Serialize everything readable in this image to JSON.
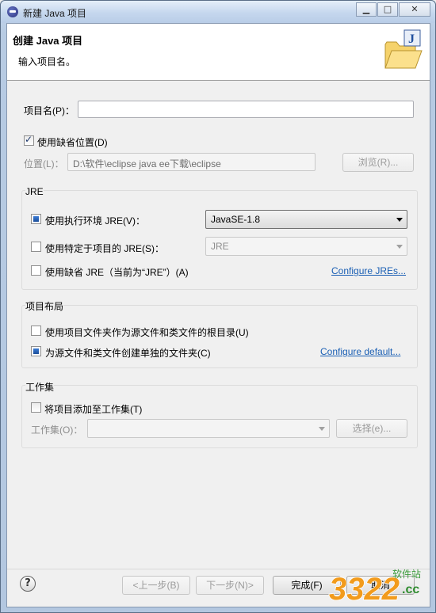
{
  "window": {
    "title": "新建 Java 项目",
    "minimize_glyph": "▁",
    "maximize_glyph": "□",
    "close_glyph": "✕"
  },
  "header": {
    "title": "创建 Java 项目",
    "description": "输入项目名。"
  },
  "project_name": {
    "label": "项目名(P)：",
    "value": ""
  },
  "location": {
    "use_default_label": "使用缺省位置(D)",
    "use_default_checked": true,
    "label": "位置(L)：",
    "value": "D:\\软件\\eclipse java ee下载\\eclipse",
    "browse_label": "浏览(R)..."
  },
  "jre": {
    "group_label": "JRE",
    "option_env_label": "使用执行环境 JRE(V)：",
    "option_env_value": "JavaSE-1.8",
    "option_project_label": "使用特定于项目的 JRE(S)：",
    "option_project_value": "JRE",
    "option_default_label": "使用缺省 JRE（当前为“JRE”）(A)",
    "configure_link": "Configure JREs...",
    "selected": "env"
  },
  "layout": {
    "group_label": "项目布局",
    "option_root_label": "使用项目文件夹作为源文件和类文件的根目录(U)",
    "option_separate_label": "为源文件和类文件创建单独的文件夹(C)",
    "configure_link": "Configure default...",
    "selected": "separate"
  },
  "working_sets": {
    "group_label": "工作集",
    "add_label": "将项目添加至工作集(T)",
    "add_checked": false,
    "label": "工作集(O)：",
    "value": "",
    "select_label": "选择(e)..."
  },
  "footer": {
    "help_glyph": "?",
    "back_label": "<上一步(B)",
    "next_label": "下一步(N)>",
    "finish_label": "完成(F)",
    "cancel_label": "取消"
  },
  "watermark": {
    "number": "3322",
    "site": "软件站",
    "domain": ".cc"
  }
}
